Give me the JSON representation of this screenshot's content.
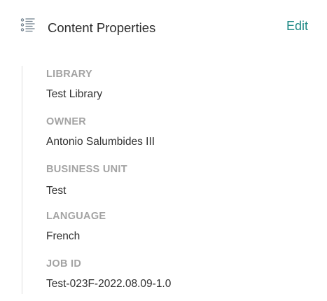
{
  "panel": {
    "title": "Content Properties",
    "edit_label": "Edit",
    "icon": "list-icon",
    "accent_color": "#1f8a86"
  },
  "properties": [
    {
      "label": "LIBRARY",
      "value": "Test Library"
    },
    {
      "label": "OWNER",
      "value": "Antonio Salumbides III"
    },
    {
      "label": "BUSINESS UNIT",
      "value": "Test"
    },
    {
      "label": "LANGUAGE",
      "value": "French"
    },
    {
      "label": "JOB ID",
      "value": "Test-023F-2022.08.09-1.0"
    }
  ]
}
